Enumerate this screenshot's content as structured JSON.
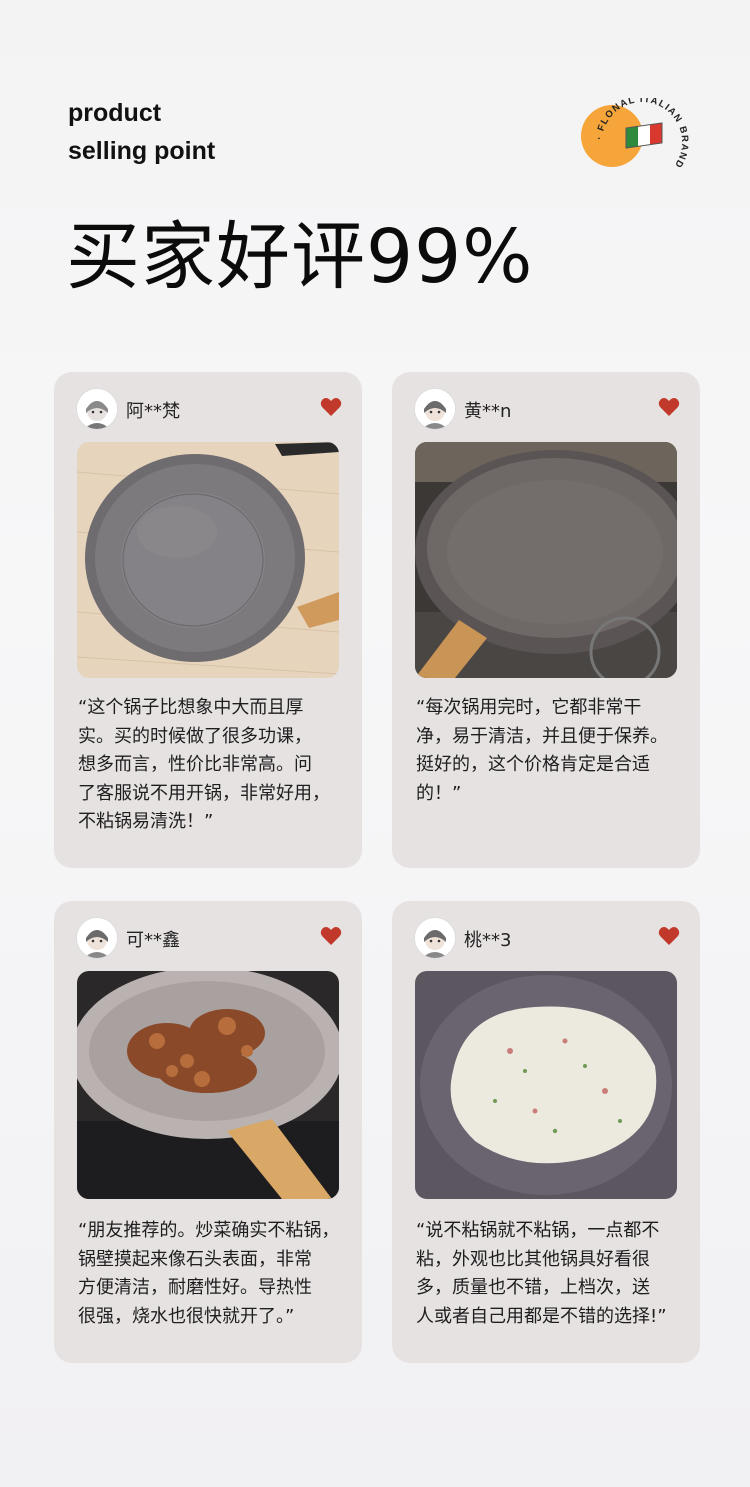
{
  "header": {
    "en_line1": "product",
    "en_line2": "selling point",
    "title": "买家好评99%"
  },
  "brand": {
    "ring_text": "· FLONAL ITALIAN BRAND",
    "colors": {
      "sun": "#f5a53a",
      "flag_green": "#2e8b3d",
      "flag_white": "#ffffff",
      "flag_red": "#d9382e"
    }
  },
  "accent": {
    "heart": "#c0392b",
    "card_bg": "#e7e2e2"
  },
  "reviews": [
    {
      "user": "阿**梵",
      "photo_icon": "gray-granite-frying-pan-photo",
      "lines": [
        "“这个锅子比想象中大而且厚",
        "实。买的时候做了很多功课，",
        "想多而言，性价比非常高。问",
        "了客服说不用开锅，非常好用，",
        "不粘锅易清洗！”"
      ]
    },
    {
      "user": "黄**n",
      "photo_icon": "pan-on-gas-stove-photo",
      "lines": [
        "“每次锅用完时，它都非常干",
        "净，易于清洁，并且便于保养。",
        "挺好的，这个价格肯定是合适",
        "的！”"
      ]
    },
    {
      "user": "可**鑫",
      "photo_icon": "stir-fried-meat-in-pan-photo",
      "lines": [
        "“朋友推荐的。炒菜确实不粘锅，",
        "锅壁摸起来像石头表面，非常",
        "方便清洁，耐磨性好。导热性",
        "很强，烧水也很快就开了。”"
      ]
    },
    {
      "user": "桃**3",
      "photo_icon": "pancake-in-pan-photo",
      "lines": [
        "“说不粘锅就不粘锅，一点都不",
        "粘，外观也比其他锅具好看很",
        "多，质量也不错，上档次，送",
        "人或者自己用都是不错的选择!”"
      ]
    }
  ]
}
